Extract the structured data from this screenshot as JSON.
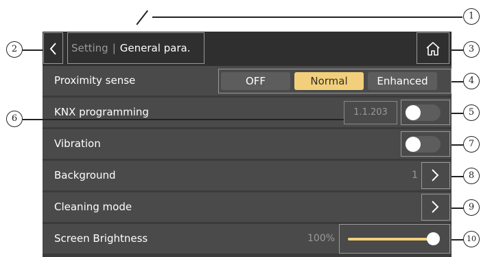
{
  "header": {
    "back_icon": "chevron-left-icon",
    "breadcrumb_parent": "Setting",
    "breadcrumb_separator": "|",
    "breadcrumb_current": "General para.",
    "home_icon": "home-icon"
  },
  "rows": {
    "proximity": {
      "label": "Proximity sense",
      "options": [
        "OFF",
        "Normal",
        "Enhanced"
      ],
      "selected": "Normal"
    },
    "knx": {
      "label": "KNX programming",
      "address": "1.1.203",
      "toggle_on": false
    },
    "vibration": {
      "label": "Vibration",
      "toggle_on": false
    },
    "background": {
      "label": "Background",
      "value": "1",
      "arrow_icon": "chevron-right-icon"
    },
    "cleaning": {
      "label": "Cleaning mode",
      "arrow_icon": "chevron-right-icon"
    },
    "brightness": {
      "label": "Screen Brightness",
      "value_text": "100%",
      "level": 1.0
    }
  },
  "callouts": [
    "1",
    "2",
    "3",
    "4",
    "5",
    "6",
    "7",
    "8",
    "9",
    "10"
  ],
  "colors": {
    "accent": "#f2cf7a",
    "panel": "#3b3b3b",
    "row": "#4a4a4a",
    "header": "#2f2f2f"
  }
}
